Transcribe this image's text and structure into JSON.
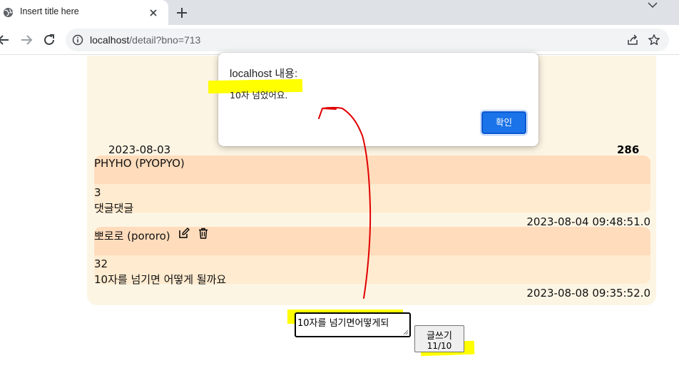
{
  "browser": {
    "tab_title": "Insert title here",
    "url_host": "localhost",
    "url_path": "/detail?bno=713"
  },
  "post": {
    "date": "2023-08-03",
    "views": "286"
  },
  "comments": [
    {
      "author": "PHYHO (PYOPYO)",
      "number": "3",
      "text": "댓글댓글",
      "date": "2023-08-04 09:48:51.0",
      "editable": false
    },
    {
      "author": "뽀로로 (pororo)",
      "number": "32",
      "text": "10자를 넘기면 어떻게 될까요",
      "date": "2023-08-08 09:35:52.0",
      "editable": true
    }
  ],
  "form": {
    "textarea_value": "10자를  넘기면어떻게되",
    "submit_label": "글쓰기",
    "char_count": "11/10"
  },
  "dialog": {
    "title": "localhost 내용:",
    "message": "10자 넘었어요.",
    "ok_label": "확인"
  },
  "colors": {
    "highlight": "#ffff00",
    "annotation": "#e00000",
    "dialog_button": "#1a73e8",
    "board_bg": "#fdf5e4",
    "comment_head": "#ffdcbc",
    "comment_body": "#ffebcf"
  }
}
